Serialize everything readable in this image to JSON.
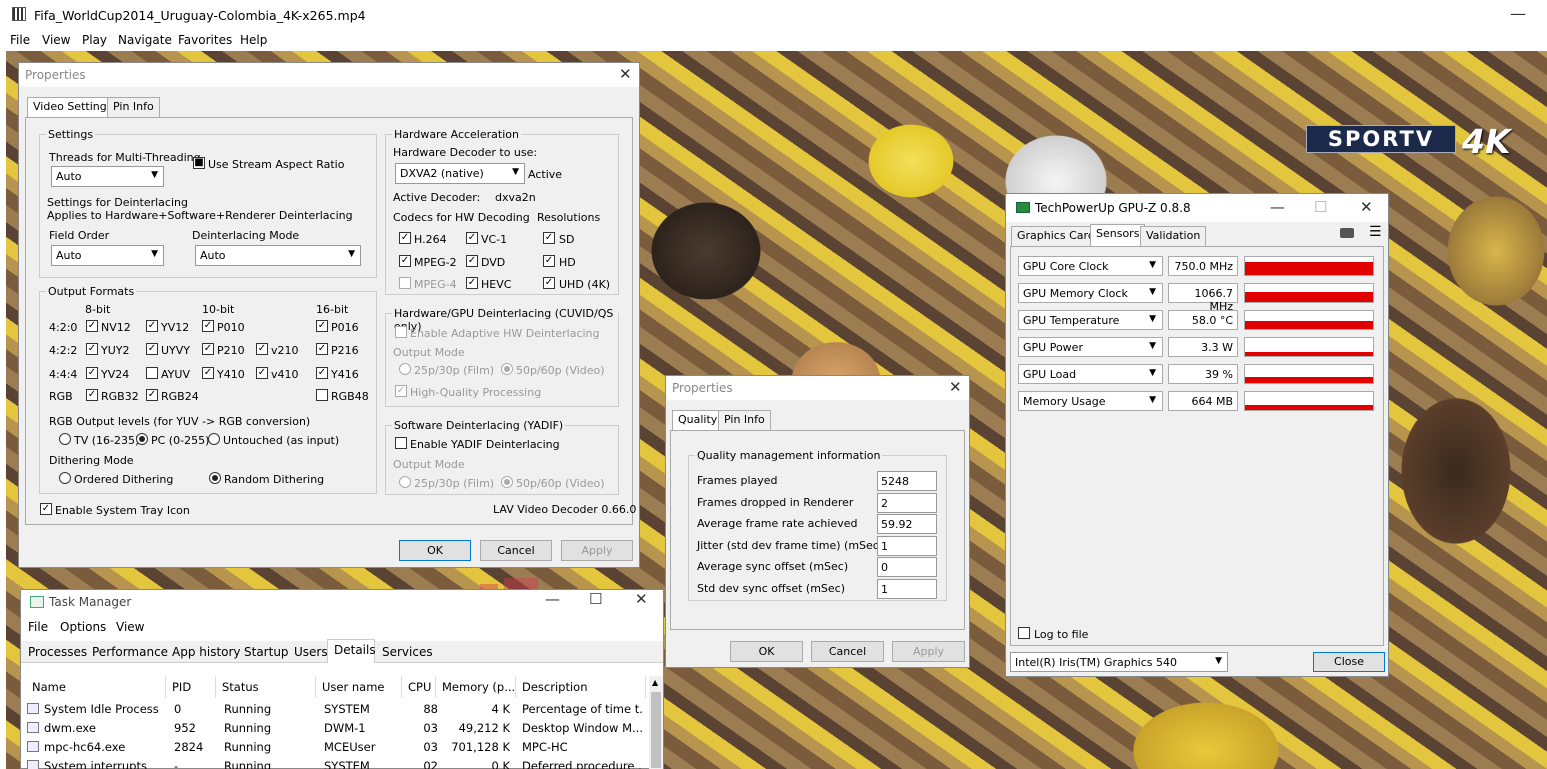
{
  "player": {
    "title": "Fifa_WorldCup2014_Uruguay-Colombia_4K-x265.mp4",
    "menu": [
      "File",
      "View",
      "Play",
      "Navigate",
      "Favorites",
      "Help"
    ],
    "channel_logo": "SPORTV",
    "channel_logo_suffix": "4K"
  },
  "lav": {
    "title": "Properties",
    "tabs": [
      "Video Settings",
      "Pin Info"
    ],
    "settings_label": "Settings",
    "threads_label": "Threads for Multi-Threading",
    "threads_value": "Auto",
    "aspect_label": "Use Stream Aspect Ratio",
    "deint_title": "Settings for Deinterlacing",
    "deint_sub": "Applies to Hardware+Software+Renderer Deinterlacing",
    "field_order_label": "Field Order",
    "field_order_value": "Auto",
    "deint_mode_label": "Deinterlacing Mode",
    "deint_mode_value": "Auto",
    "output_formats_label": "Output Formats",
    "bit8": "8-bit",
    "bit10": "10-bit",
    "bit16": "16-bit",
    "row_labels": [
      "4:2:0",
      "4:2:2",
      "4:4:4",
      "RGB"
    ],
    "formats": [
      "NV12",
      "YV12",
      "P010",
      "P016",
      "YUY2",
      "UYVY",
      "P210",
      "v210",
      "P216",
      "YV24",
      "AYUV",
      "Y410",
      "v410",
      "Y416",
      "RGB32",
      "RGB24",
      "RGB48"
    ],
    "rgb_levels_label": "RGB Output levels (for YUV -> RGB conversion)",
    "rgb_tv": "TV (16-235)",
    "rgb_pc": "PC (0-255)",
    "rgb_untouched": "Untouched (as input)",
    "dither_label": "Dithering Mode",
    "dither_ordered": "Ordered Dithering",
    "dither_random": "Random Dithering",
    "tray_label": "Enable System Tray Icon",
    "hw_accel_label": "Hardware Acceleration",
    "hw_decoder_label": "Hardware Decoder to use:",
    "hw_decoder_value": "DXVA2 (native)",
    "hw_status": "Active",
    "active_decoder_label": "Active Decoder:",
    "active_decoder_value": "dxva2n",
    "codecs_label": "Codecs for HW Decoding",
    "resolutions_label": "Resolutions",
    "codecs": [
      "H.264",
      "VC-1",
      "SD",
      "MPEG-2",
      "DVD",
      "HD",
      "MPEG-4",
      "HEVC",
      "UHD (4K)"
    ],
    "hw_deint_label": "Hardware/GPU Deinterlacing (CUVID/QS only)",
    "hw_deint_enable": "Enable Adaptive HW Deinterlacing",
    "output_mode_label": "Output Mode",
    "mode_film": "25p/30p (Film)",
    "mode_video": "50p/60p (Video)",
    "hq_label": "High-Quality Processing",
    "sw_deint_label": "Software Deinterlacing (YADIF)",
    "yadif_label": "Enable YADIF Deinterlacing",
    "version": "LAV Video Decoder 0.66.0",
    "ok": "OK",
    "cancel": "Cancel",
    "apply": "Apply"
  },
  "quality": {
    "title": "Properties",
    "tabs": [
      "Quality",
      "Pin Info"
    ],
    "group_label": "Quality management information",
    "rows": [
      {
        "label": "Frames played",
        "value": "5248"
      },
      {
        "label": "Frames dropped in Renderer",
        "value": "2"
      },
      {
        "label": "Average frame rate achieved",
        "value": "59.92"
      },
      {
        "label": "Jitter (std dev frame time) (mSec)",
        "value": "1"
      },
      {
        "label": "Average sync offset (mSec)",
        "value": "0"
      },
      {
        "label": "Std dev sync offset (mSec)",
        "value": "1"
      }
    ],
    "ok": "OK",
    "cancel": "Cancel",
    "apply": "Apply"
  },
  "gpuz": {
    "title": "TechPowerUp GPU-Z 0.8.8",
    "tabs": [
      "Graphics Card",
      "Sensors",
      "Validation"
    ],
    "sensors": [
      {
        "name": "GPU Core Clock",
        "value": "750.0 MHz",
        "level": 0.7
      },
      {
        "name": "GPU Memory Clock",
        "value": "1066.7 MHz",
        "level": 0.55
      },
      {
        "name": "GPU Temperature",
        "value": "58.0 °C",
        "level": 0.45
      },
      {
        "name": "GPU Power",
        "value": "3.3 W",
        "level": 0.2
      },
      {
        "name": "GPU Load",
        "value": "39 %",
        "level": 0.35
      },
      {
        "name": "Memory Usage",
        "value": "664 MB",
        "level": 0.3
      }
    ],
    "log_label": "Log to file",
    "gpu_select": "Intel(R) Iris(TM) Graphics 540",
    "close": "Close"
  },
  "taskmgr": {
    "title": "Task Manager",
    "menu": [
      "File",
      "Options",
      "View"
    ],
    "tabs": [
      "Processes",
      "Performance",
      "App history",
      "Startup",
      "Users",
      "Details",
      "Services"
    ],
    "columns": [
      "Name",
      "PID",
      "Status",
      "User name",
      "CPU",
      "Memory (p...",
      "Description"
    ],
    "rows": [
      [
        "System Idle Process",
        "0",
        "Running",
        "SYSTEM",
        "88",
        "4 K",
        "Percentage of time t..."
      ],
      [
        "dwm.exe",
        "952",
        "Running",
        "DWM-1",
        "03",
        "49,212 K",
        "Desktop Window M..."
      ],
      [
        "mpc-hc64.exe",
        "2824",
        "Running",
        "MCEUser",
        "03",
        "701,128 K",
        "MPC-HC"
      ],
      [
        "System interrupts",
        "-",
        "Running",
        "SYSTEM",
        "02",
        "0 K",
        "Deferred procedure ..."
      ]
    ]
  },
  "colors": {
    "accent": "#0078d7",
    "graph": "#e00000"
  }
}
